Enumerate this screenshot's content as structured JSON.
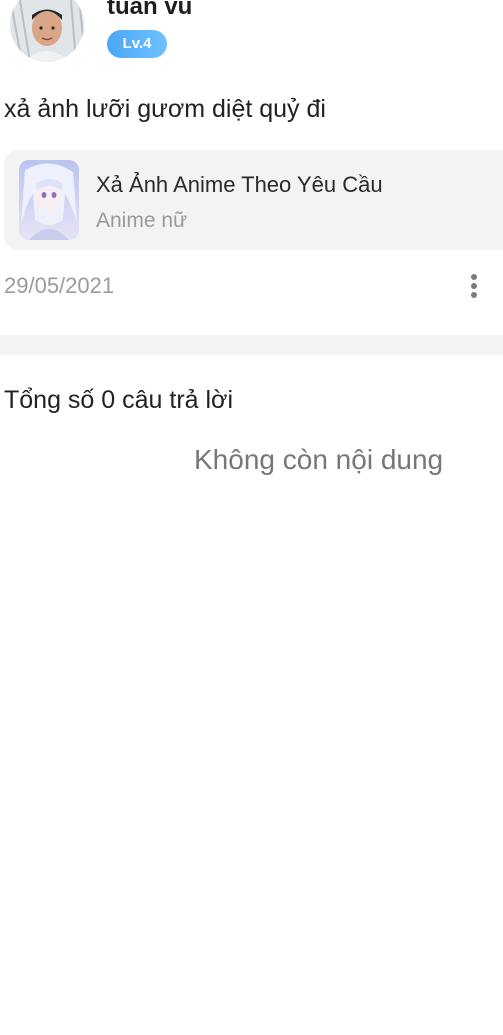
{
  "author": {
    "name": "tuan vu",
    "level": "Lv.4"
  },
  "post": {
    "text": "xả ảnh lưỡi gươm diệt quỷ đi",
    "date": "29/05/2021"
  },
  "group": {
    "title": "Xả Ảnh Anime Theo Yêu Cầu",
    "subtitle": "Anime nữ"
  },
  "answers": {
    "summary": "Tổng số 0 câu trả lời",
    "empty_text": "Không còn nội dung"
  },
  "colors": {
    "badge": "#4aa8f7",
    "card_bg": "#f3f3f4",
    "muted_text": "#9b9b9b"
  },
  "icons": {
    "more": "more-vertical-icon"
  }
}
